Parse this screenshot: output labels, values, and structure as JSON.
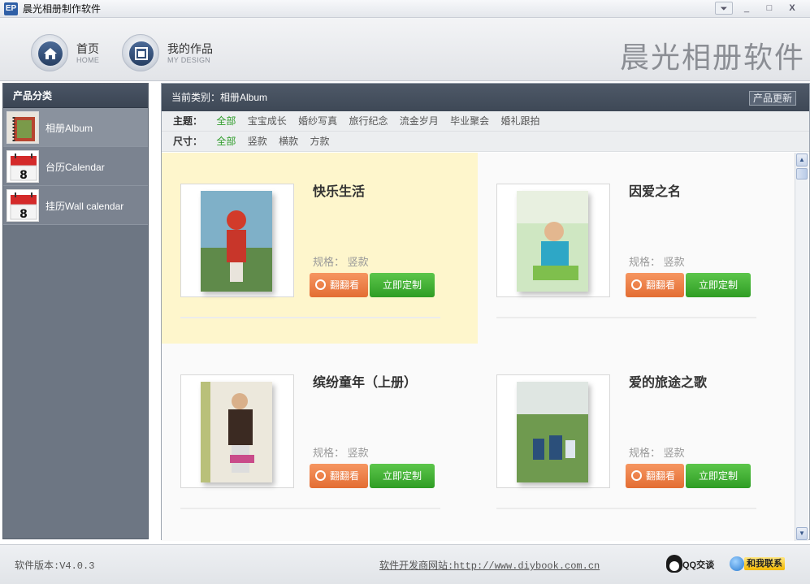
{
  "window": {
    "icon_text": "EP",
    "title": "晨光相册制作软件",
    "menu_glyph": "⏷",
    "min_glyph": "_",
    "max_glyph": "□",
    "close_glyph": "X"
  },
  "nav": {
    "home_label": "首页",
    "home_sub": "HOME",
    "design_label": "我的作品",
    "design_sub": "MY DESIGN"
  },
  "brand": "晨光相册软件",
  "sidebar": {
    "header": "产品分类",
    "items": [
      {
        "label": "相册Album",
        "icon": "album-icon"
      },
      {
        "label": "台历Calendar",
        "icon": "calendar-icon"
      },
      {
        "label": "挂历Wall calendar",
        "icon": "wall-calendar-icon"
      }
    ]
  },
  "main": {
    "current_category": "当前类别：相册Album",
    "update_button": "产品更新",
    "filters": {
      "theme_label": "主题：",
      "theme_options": [
        "全部",
        "宝宝成长",
        "婚纱写真",
        "旅行纪念",
        "流金岁月",
        "毕业聚会",
        "婚礼跟拍"
      ],
      "theme_selected": "全部",
      "size_label": "尺寸：",
      "size_options": [
        "全部",
        "竖款",
        "横款",
        "方款"
      ],
      "size_selected": "全部"
    },
    "products": [
      {
        "title": "快乐生活",
        "spec": "规格：  竖款",
        "preview": "翻翻看",
        "customize": "立即定制"
      },
      {
        "title": "因爱之名",
        "spec": "规格：  竖款",
        "preview": "翻翻看",
        "customize": "立即定制"
      },
      {
        "title": "缤纷童年（上册）",
        "spec": "规格：  竖款",
        "preview": "翻翻看",
        "customize": "立即定制"
      },
      {
        "title": "爱的旅途之歌",
        "spec": "规格：  竖款",
        "preview": "翻翻看",
        "customize": "立即定制"
      }
    ]
  },
  "status": {
    "version": "软件版本:V4.0.3",
    "website": "软件开发商网站:http://www.diybook.com.cn",
    "qq_label": "QQ交谈",
    "contact_label": "和我联系"
  },
  "colors": {
    "accent_green": "#2e9c2a",
    "header_dark": "#3e4856",
    "highlight": "#fef6cc",
    "preview_orange": "#e36d33",
    "customize_green": "#2f9d24"
  }
}
